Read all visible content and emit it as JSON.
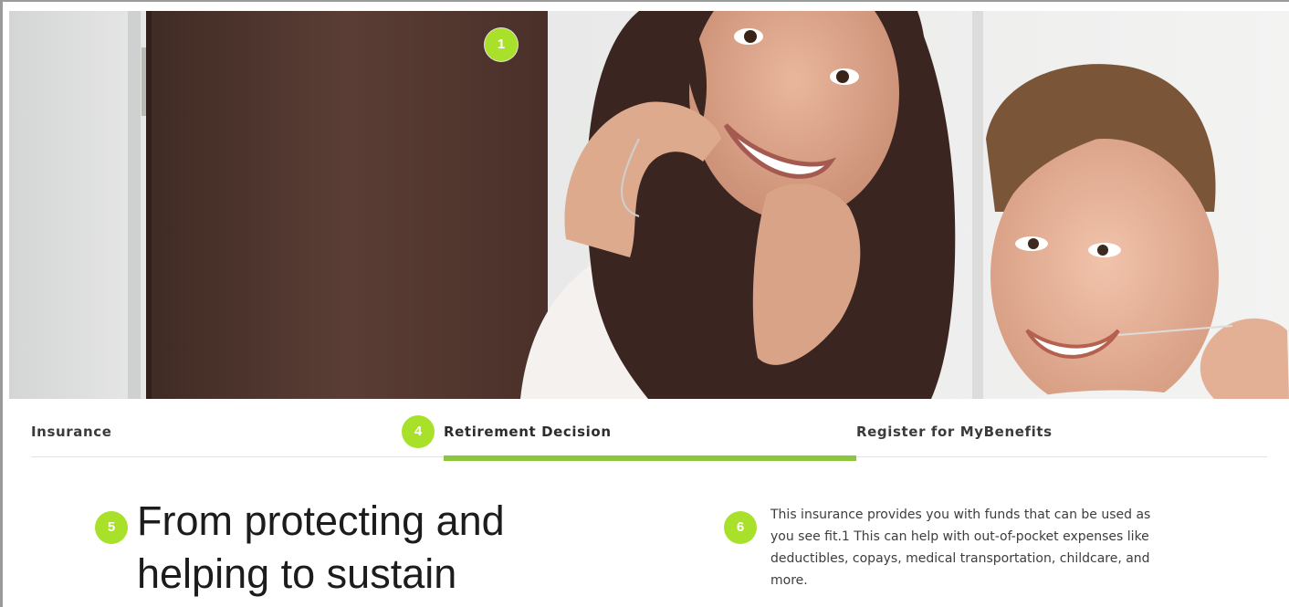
{
  "hero": {
    "image_name": "mother-and-son-flossing-photo"
  },
  "annotations": {
    "one": "1",
    "four": "4",
    "five": "5",
    "six": "6"
  },
  "tabs": [
    {
      "label": "Insurance",
      "active": false
    },
    {
      "label": "Retirement Decision",
      "active": true
    },
    {
      "label": "Register for MyBenefits",
      "active": false
    }
  ],
  "content": {
    "headline": "From protecting and helping to sustain",
    "body": "This insurance provides you with funds that can be used as you see fit.1 This can help with out-of-pocket expenses like deductibles, copays, medical transportation, childcare, and more."
  },
  "colors": {
    "accent": "#8cc63f",
    "annotation": "#a8e02a",
    "text": "#1c1c1c"
  }
}
